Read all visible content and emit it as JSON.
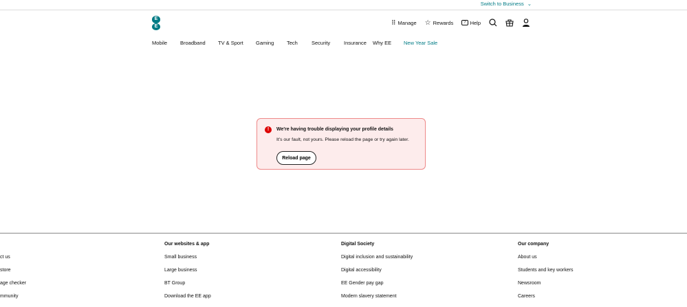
{
  "topbar": {
    "switch_label": "Switch to Business"
  },
  "logo": {
    "letters": [
      "E",
      "E"
    ]
  },
  "utility": {
    "manage": "Manage",
    "rewards": "Rewards",
    "help": "Help"
  },
  "nav": [
    "Mobile",
    "Broadband",
    "TV & Sport",
    "Gaming",
    "Tech",
    "Security",
    "Insurance",
    "Why EE",
    "New Year Sale"
  ],
  "error": {
    "title": "We're having trouble displaying your profile details",
    "message": "It's our fault, not yours. Please reload the page or try again later.",
    "button": "Reload page",
    "icon": "!"
  },
  "footer": {
    "col0": {
      "links": [
        "ct us",
        "store",
        "age checker",
        "mmunity"
      ]
    },
    "col1": {
      "title": "Our websites & app",
      "links": [
        "Small business",
        "Large business",
        "BT Group",
        "Download the EE app"
      ]
    },
    "col2": {
      "title": "Digital Society",
      "links": [
        "Digital inclusion and sustainability",
        "Digital accessibility",
        "EE Gender pay gap",
        "Modern slavery statement"
      ]
    },
    "col3": {
      "title": "Our company",
      "links": [
        "About us",
        "Students and key workers",
        "Newsroom",
        "Careers"
      ]
    }
  },
  "colors": {
    "brand": "#007b85",
    "error_bg": "#fdecec",
    "error_icon": "#dd0000"
  }
}
